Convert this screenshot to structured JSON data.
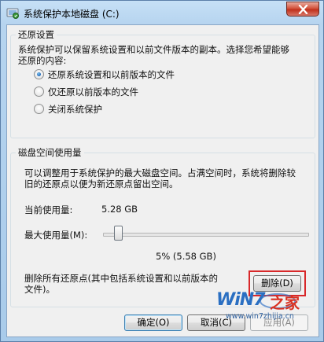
{
  "window": {
    "title": "系统保护本地磁盘 (C:)",
    "close_label": "×"
  },
  "restore_settings": {
    "group_label": "还原设置",
    "description_line1": "系统保护可以保留系统设置和以前文件版本的副本。选择您希望能够",
    "description_line2": "还原的内容:",
    "options": [
      {
        "label": "还原系统设置和以前版本的文件",
        "checked": true
      },
      {
        "label": "仅还原以前版本的文件",
        "checked": false
      },
      {
        "label": "关闭系统保护",
        "checked": false
      }
    ]
  },
  "disk_usage": {
    "group_label": "磁盘空间使用量",
    "description_line1": "可以调整用于系统保护的最大磁盘空间。占满空间时，系统将删除较",
    "description_line2": "旧的还原点以便为新还原点留出空间。",
    "current_usage_label": "当前使用量:",
    "current_usage_value": "5.28 GB",
    "max_usage_label": "最大使用量(M):",
    "max_usage_fraction": 0.05,
    "max_usage_value": "5% (5.58 GB)",
    "delete_text_line1": "删除所有还原点(其中包括系统设置和以前版本的",
    "delete_text_line2": "文件)。",
    "delete_button": "删除(D)"
  },
  "footer": {
    "ok_button": "确定(O)",
    "cancel_button": "取消(C)",
    "apply_button": "应用(A)"
  },
  "watermark": {
    "brand_part1": "WiN7",
    "brand_part2": "之家",
    "url": "www.win7zhijia.cn"
  },
  "colors": {
    "highlight": "#d8282a",
    "radio_selected": "#1f66b6"
  }
}
